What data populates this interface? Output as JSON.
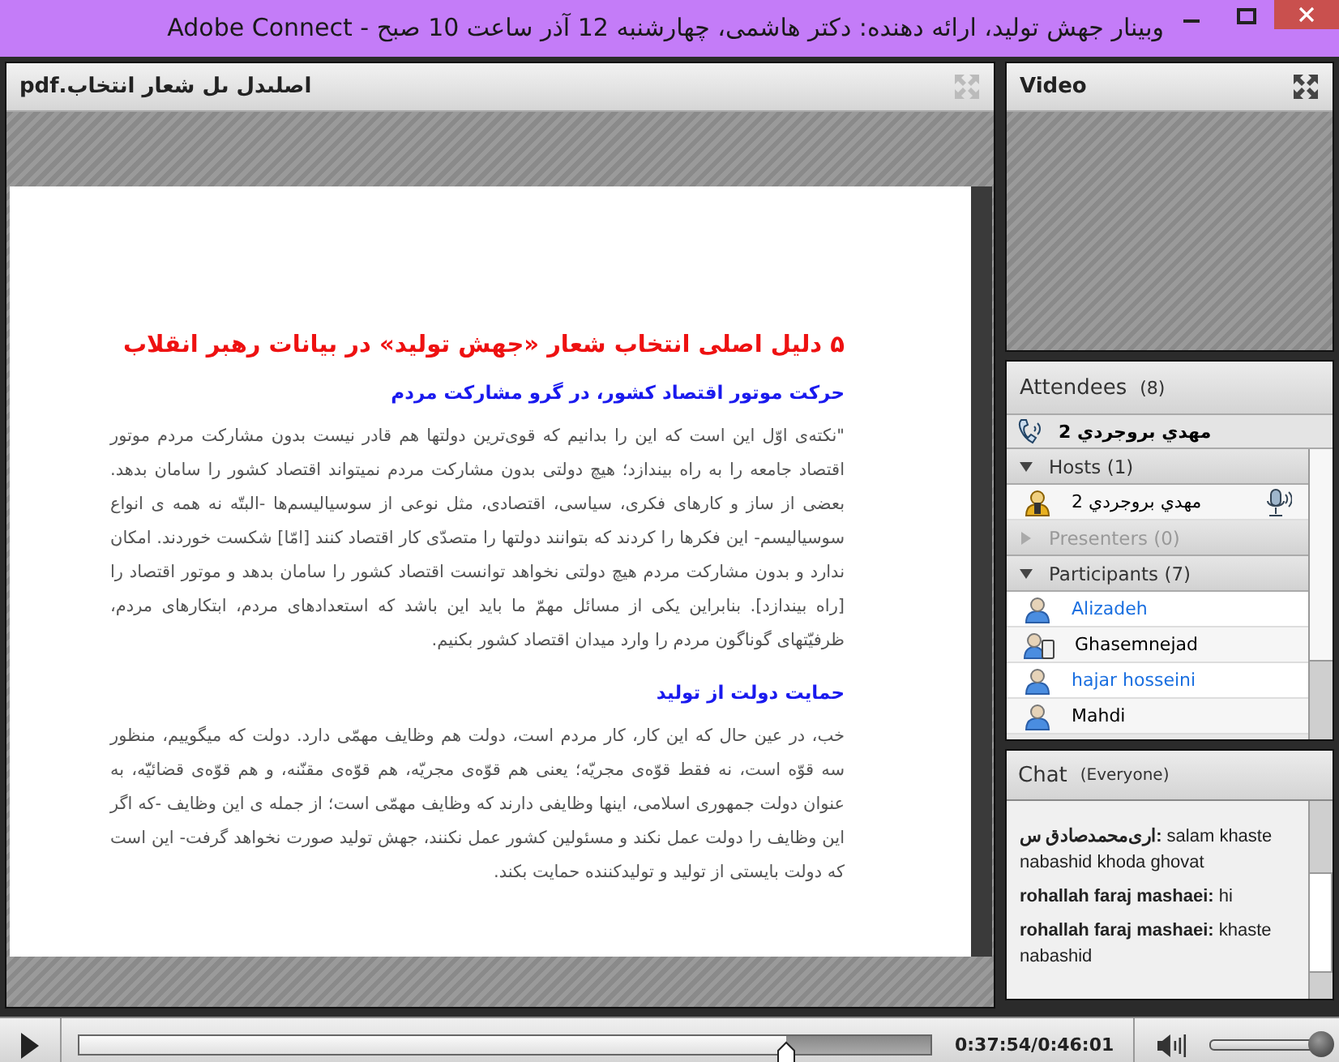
{
  "window": {
    "title": "وبینار جهش تولید، ارائه دهنده: دکتر هاشمی، چهارشنبه 12 آذر ساعت 10 صبح - Adobe Connect"
  },
  "document_pod": {
    "title": "اصلىدل ىل شعار انتخاب.pdf",
    "heading": "۵ دلیل اصلی انتخاب شعار «جهش تولید» در بیانات رهبر انقلاب",
    "sections": [
      {
        "heading": "حرکت موتور اقتصاد کشور، در گرو مشارکت مردم",
        "body": "\"نکته‌ی اوّل این است که این را بدانیم که قوی‌ترین دولتها هم قادر نیست بدون مشارکت مردم موتور اقتصاد جامعه را به راه بیندازد؛ هیچ دولتی بدون مشارکت مردم نمیتواند اقتصاد کشور را سامان بدهد. بعضی از ساز و کارهای فکری، سیاسی، اقتصادی، مثل نوعی از سوسیالیسم‌ها -البتّه نه همه ی انواع سوسیالیسم- این فکرها را کردند که بتوانند دولتها را متصدّی کار اقتصاد کنند [امّا] شکست خوردند. امکان ندارد و بدون مشارکت مردم هیچ دولتی نخواهد توانست اقتصاد کشور را سامان بدهد و موتور اقتصاد را [راه بیندازد]. بنابراین یکی از مسائل مهمّ ما باید این باشد که استعدادهای مردم، ابتکارهای مردم، ظرفیّتهای گوناگون مردم را وارد میدان اقتصاد کشور بکنیم."
      },
      {
        "heading": "حمایت دولت از تولید",
        "body": "خب، در عین حال که این کار، کار مردم است، دولت هم وظایف مهمّی دارد. دولت که میگوییم، منظور سه قوّه است، نه فقط قوّه‌ی مجریّه؛ یعنی هم قوّه‌ی مجریّه، هم قوّه‌ی مقنّنه، و هم قوّه‌ی قضائیّه، به عنوان دولت جمهوری اسلامی، اینها وظایفی دارند که وظایف مهمّی است؛ از جمله ی این وظایف -که اگر این وظایف را دولت عمل نکند و مسئولین کشور عمل نکنند، جهش تولید صورت نخواهد گرفت- این است که دولت بایستی از تولید و تولیدکننده حمایت بکند."
      }
    ]
  },
  "video_pod": {
    "title": "Video"
  },
  "attendees": {
    "title": "Attendees",
    "count": "(8)",
    "speaking": "مهدي بروجردي 2",
    "groups": [
      {
        "label": "Hosts (1)",
        "expanded": true,
        "disabled": false,
        "members": [
          {
            "name": "مهدي بروجردي 2",
            "kind": "host",
            "mic": true,
            "color": "#000000"
          }
        ]
      },
      {
        "label": "Presenters (0)",
        "expanded": false,
        "disabled": true
      },
      {
        "label": "Participants (7)",
        "expanded": true,
        "disabled": false,
        "members": [
          {
            "name": "Alizadeh",
            "kind": "participant",
            "mic": false,
            "color": "#1a6fe0"
          },
          {
            "name": "Ghasemnejad",
            "kind": "mobile",
            "mic": false,
            "color": "#000000"
          },
          {
            "name": "hajar hosseini",
            "kind": "participant",
            "mic": false,
            "color": "#1a6fe0"
          },
          {
            "name": "Mahdi",
            "kind": "participant",
            "mic": false,
            "color": "#000000"
          }
        ]
      }
    ]
  },
  "chat": {
    "title": "Chat",
    "audience": "(Everyone)",
    "messages": [
      {
        "sender": "اری‌محمدصادق س:",
        "text": "salam khaste nabashid khoda ghovat"
      },
      {
        "sender": "rohallah faraj mashaei:",
        "text": "hi"
      },
      {
        "sender": "rohallah faraj mashaei:",
        "text": "khaste nabashid"
      }
    ]
  },
  "playback": {
    "level": 0.83,
    "time": "0:37:54/0:46:01",
    "volume": {
      "level": 0.97
    }
  }
}
